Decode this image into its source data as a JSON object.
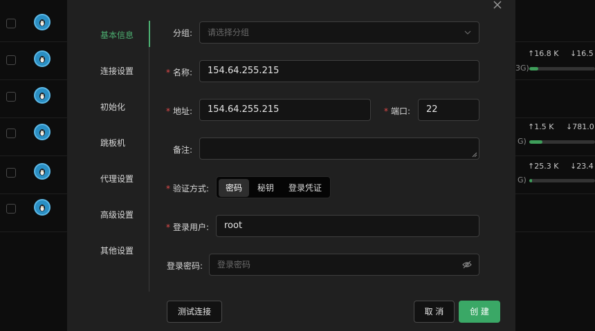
{
  "background": {
    "rows": [
      {
        "up": "",
        "down": "",
        "mem": "",
        "fill": 0
      },
      {
        "up": "↑16.8 K",
        "down": "↓16.5",
        "mem": "3G)",
        "fill": 0.14
      },
      {
        "up": "",
        "down": "",
        "mem": "",
        "fill": 0
      },
      {
        "up": "↑1.5 K",
        "down": "↓781.0",
        "mem": "G)",
        "fill": 0.2
      },
      {
        "up": "↑25.3 K",
        "down": "↓23.4",
        "mem": "G)",
        "fill": 0.04
      },
      {
        "up": "",
        "down": "",
        "mem": "",
        "fill": 0
      }
    ]
  },
  "nav": {
    "items": [
      {
        "label": "基本信息"
      },
      {
        "label": "连接设置"
      },
      {
        "label": "初始化"
      },
      {
        "label": "跳板机"
      },
      {
        "label": "代理设置"
      },
      {
        "label": "高级设置"
      },
      {
        "label": "其他设置"
      }
    ]
  },
  "form": {
    "group": {
      "label": "分组:",
      "placeholder": "请选择分组"
    },
    "name": {
      "label": "名称:",
      "value": "154.64.255.215"
    },
    "address": {
      "label": "地址:",
      "value": "154.64.255.215"
    },
    "port": {
      "label": "端口:",
      "value": "22"
    },
    "remark": {
      "label": "备注:",
      "value": ""
    },
    "auth": {
      "label": "验证方式:",
      "options": [
        "密码",
        "秘钥",
        "登录凭证"
      ],
      "selected": "密码"
    },
    "user": {
      "label": "登录用户:",
      "value": "root"
    },
    "password": {
      "label": "登录密码:",
      "placeholder": "登录密码"
    }
  },
  "footer": {
    "test_label": "测试连接",
    "cancel_label": "取 消",
    "create_label": "创 建"
  },
  "colors": {
    "accent": "#3aa866",
    "required": "#e04a4a",
    "avatar": "#2a8fc4"
  }
}
